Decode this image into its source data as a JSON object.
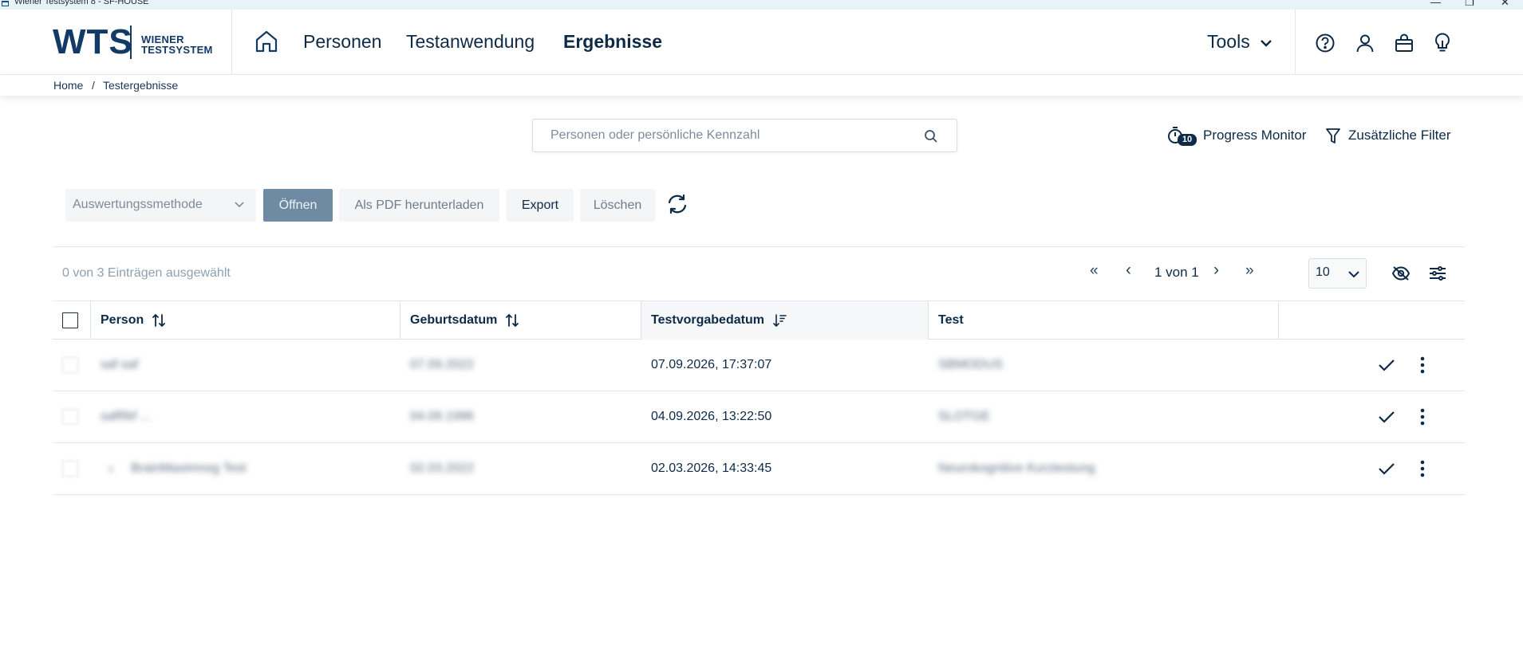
{
  "window": {
    "title": "Wiener Testsystem 8 - SF-HOUSE",
    "controls": [
      "—",
      "❐",
      "✕"
    ]
  },
  "logo": {
    "mark": "WTS",
    "line1": "WIENER",
    "line2": "TESTSYSTEM"
  },
  "nav": {
    "items": [
      {
        "label": "Personen",
        "active": false
      },
      {
        "label": "Testanwendung",
        "active": false
      },
      {
        "label": "Ergebnisse",
        "active": true
      }
    ],
    "tools_label": "Tools",
    "icons": [
      "home-icon",
      "chevron-down-icon",
      "help-icon",
      "user-icon",
      "shopping-bag-icon",
      "lightbulb-icon"
    ]
  },
  "breadcrumb": {
    "home": "Home",
    "separator": "/",
    "current": "Testergebnisse"
  },
  "search": {
    "placeholder": "Personen oder persönliche Kennzahl"
  },
  "tools": {
    "progress_badge": "10",
    "progress_label": "Progress Monitor",
    "filter_label": "Zusätzliche Filter"
  },
  "toolbar": {
    "method_placeholder": "Auswertungssmethode",
    "open_label": "Öffnen",
    "pdf_label": "Als PDF herunterladen",
    "export_label": "Export",
    "delete_label": "Löschen"
  },
  "pager": {
    "selection_text": "0 von 3 Einträgen ausgewählt",
    "first": "«",
    "prev": "‹",
    "page_text": "1 von 1",
    "next": "›",
    "last": "»",
    "page_size": "10"
  },
  "table": {
    "columns": [
      {
        "label": "Person",
        "sort": "both"
      },
      {
        "label": "Geburtsdatum",
        "sort": "both"
      },
      {
        "label": "Testvorgabedatum",
        "sort": "desc"
      },
      {
        "label": "Test",
        "sort": "none"
      }
    ],
    "rows": [
      {
        "person": "saf saf",
        "birth": "07.09.2022",
        "date": "07.09.2026, 17:37:07",
        "test": "SBMODUS"
      },
      {
        "person": "safRkf ...",
        "birth": "04.09.1996",
        "date": "04.09.2026, 13:22:50",
        "test": "SLOTGE"
      },
      {
        "person": "BrainMaximnog Test",
        "birth": "02.03.2022",
        "date": "02.03.2026, 14:33:45",
        "test": "Neurokognitive Kurztestung"
      }
    ]
  },
  "colors": {
    "primary_text": "#0d2a47",
    "brand": "#123a66",
    "disabled_button": "#6f8aa3",
    "border": "#e3e8ee"
  }
}
